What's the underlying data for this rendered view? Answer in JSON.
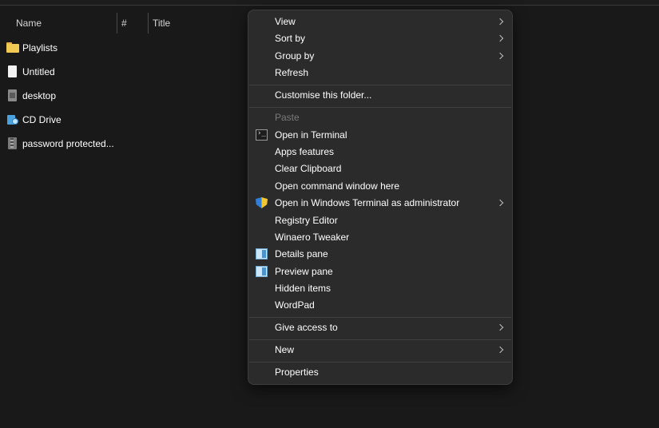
{
  "columns": {
    "name": "Name",
    "number": "#",
    "title": "Title"
  },
  "files": [
    {
      "label": "Playlists",
      "icon": "folder-icon"
    },
    {
      "label": "Untitled",
      "icon": "document-icon"
    },
    {
      "label": "desktop",
      "icon": "file-icon"
    },
    {
      "label": "CD Drive",
      "icon": "drive-icon"
    },
    {
      "label": "password protected...",
      "icon": "archive-icon"
    }
  ],
  "menu": {
    "view": "View",
    "sort_by": "Sort by",
    "group_by": "Group by",
    "refresh": "Refresh",
    "customise": "Customise this folder...",
    "paste": "Paste",
    "open_terminal": "Open in Terminal",
    "apps_features": "Apps  features",
    "clear_clipboard": "Clear Clipboard",
    "open_cmd": "Open command window here",
    "open_wt_admin": "Open in Windows Terminal as administrator",
    "registry": "Registry Editor",
    "winaero": "Winaero Tweaker",
    "details_pane": "Details pane",
    "preview_pane": "Preview pane",
    "hidden_items": "Hidden items",
    "wordpad": "WordPad",
    "give_access": "Give access to",
    "new": "New",
    "properties": "Properties"
  },
  "colors": {
    "background": "#191919",
    "menu_bg": "#2b2b2b",
    "disabled_text": "#7a7a7a",
    "folder": "#f3c955"
  }
}
